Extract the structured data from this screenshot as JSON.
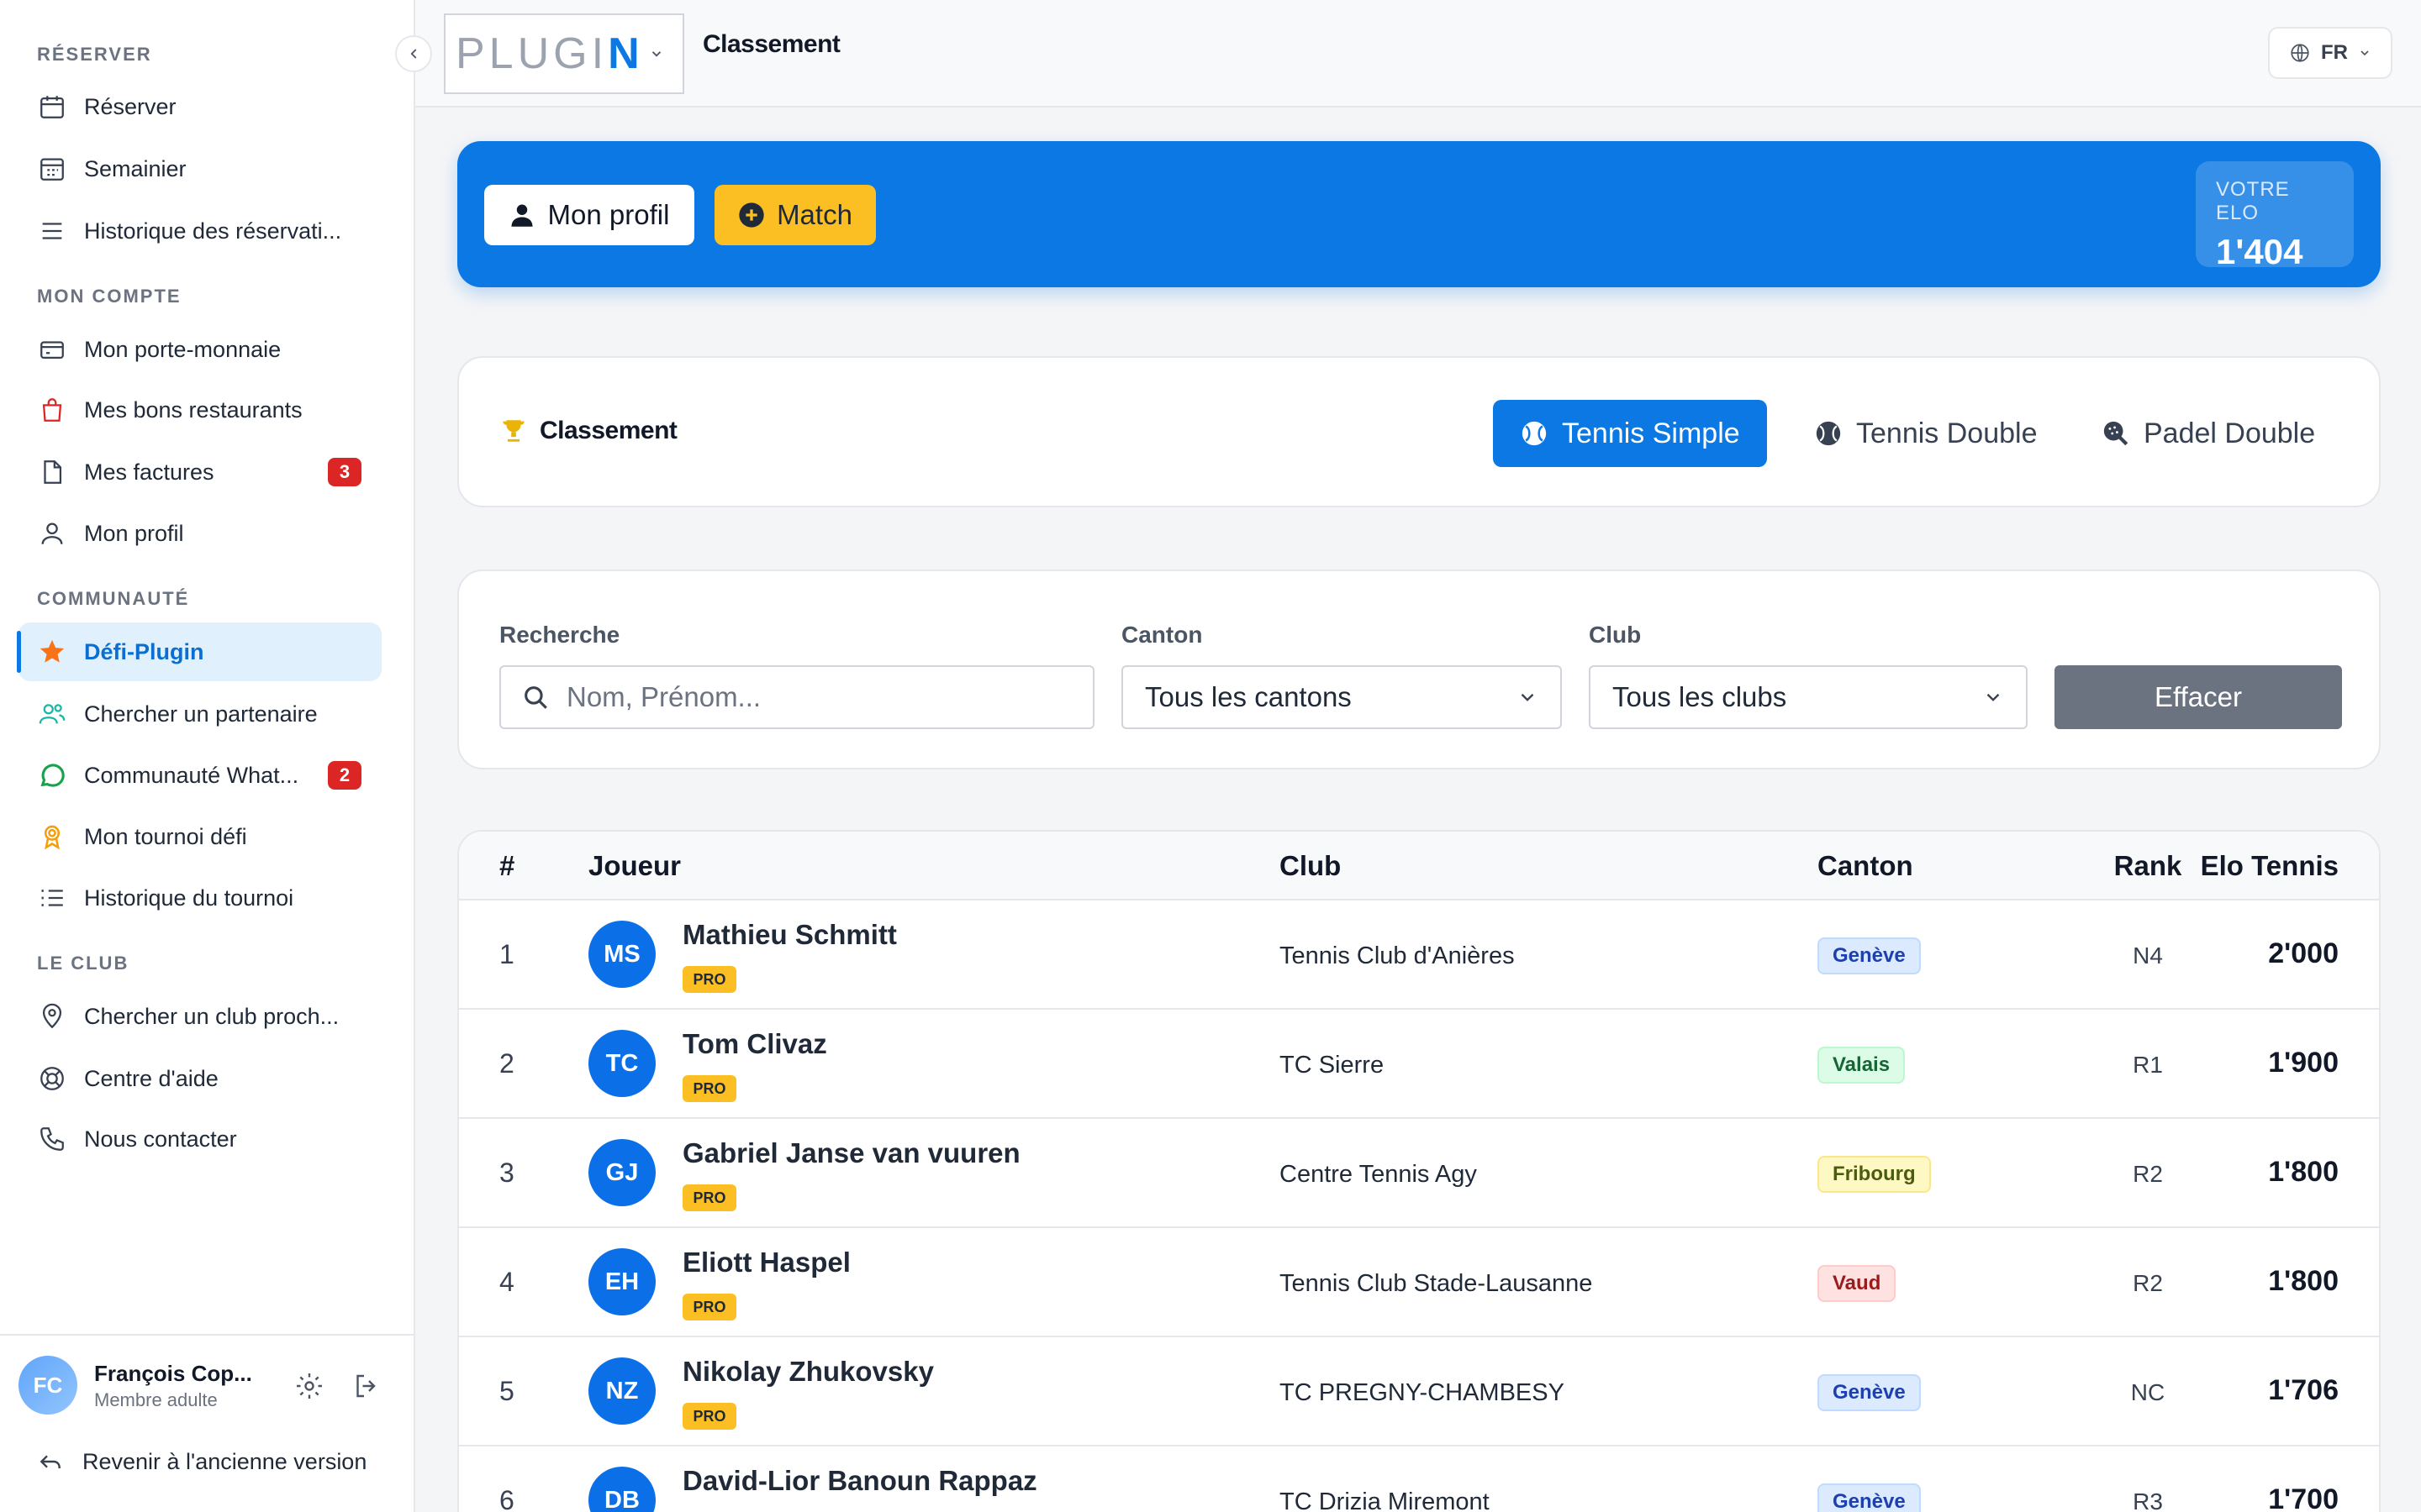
{
  "sidebar": {
    "sections": [
      {
        "title": "RÉSERVER",
        "items": [
          {
            "label": "Réserver",
            "icon": "calendar-icon"
          },
          {
            "label": "Semainier",
            "icon": "calendar-week-icon"
          },
          {
            "label": "Historique des réservati...",
            "icon": "list-icon"
          }
        ]
      },
      {
        "title": "MON COMPTE",
        "items": [
          {
            "label": "Mon porte-monnaie",
            "icon": "wallet-icon"
          },
          {
            "label": "Mes bons restaurants",
            "icon": "shopping-bag-icon"
          },
          {
            "label": "Mes factures",
            "icon": "document-icon",
            "badge": "3"
          },
          {
            "label": "Mon profil",
            "icon": "user-icon"
          }
        ]
      },
      {
        "title": "COMMUNAUTÉ",
        "items": [
          {
            "label": "Défi-Plugin",
            "icon": "star-icon",
            "active": true
          },
          {
            "label": "Chercher un partenaire",
            "icon": "users-icon"
          },
          {
            "label": "Communauté What...",
            "icon": "whatsapp-icon",
            "badge": "2"
          },
          {
            "label": "Mon tournoi défi",
            "icon": "award-icon"
          },
          {
            "label": "Historique du tournoi",
            "icon": "list-ordered-icon"
          }
        ]
      },
      {
        "title": "LE CLUB",
        "items": [
          {
            "label": "Chercher un club proch...",
            "icon": "map-pin-icon"
          },
          {
            "label": "Centre d'aide",
            "icon": "lifebuoy-icon"
          },
          {
            "label": "Nous contacter",
            "icon": "phone-icon"
          }
        ]
      }
    ],
    "user": {
      "initials": "FC",
      "name": "François Cop...",
      "role": "Membre adulte"
    },
    "revert_label": "Revenir à l'ancienne version"
  },
  "header": {
    "logo_text": "PLUGI",
    "logo_accent": "N",
    "title": "Classement",
    "lang": "FR"
  },
  "banner": {
    "profile_label": "Mon profil",
    "match_label": "Match",
    "elo_label": "VOTRE ELO",
    "elo_value": "1'404"
  },
  "ranking": {
    "title": "Classement",
    "tabs": [
      {
        "label": "Tennis Simple",
        "active": true
      },
      {
        "label": "Tennis Double",
        "active": false
      },
      {
        "label": "Padel Double",
        "active": false
      }
    ]
  },
  "filters": {
    "search_label": "Recherche",
    "search_placeholder": "Nom, Prénom...",
    "canton_label": "Canton",
    "canton_value": "Tous les cantons",
    "club_label": "Club",
    "club_value": "Tous les clubs",
    "clear_label": "Effacer"
  },
  "table": {
    "headers": {
      "num": "#",
      "player": "Joueur",
      "club": "Club",
      "canton": "Canton",
      "rank": "Rank",
      "elo": "Elo Tennis"
    },
    "rows": [
      {
        "num": "1",
        "initials": "MS",
        "name": "Mathieu Schmitt",
        "badge": "PRO",
        "club": "Tennis Club d'Anières",
        "canton": "Genève",
        "canton_color": "geneve",
        "rank": "N4",
        "elo": "2'000"
      },
      {
        "num": "2",
        "initials": "TC",
        "name": "Tom Clivaz",
        "badge": "PRO",
        "club": "TC Sierre",
        "canton": "Valais",
        "canton_color": "valais",
        "rank": "R1",
        "elo": "1'900"
      },
      {
        "num": "3",
        "initials": "GJ",
        "name": "Gabriel Janse van vuuren",
        "badge": "PRO",
        "club": "Centre Tennis Agy",
        "canton": "Fribourg",
        "canton_color": "fribourg",
        "rank": "R2",
        "elo": "1'800"
      },
      {
        "num": "4",
        "initials": "EH",
        "name": "Eliott Haspel",
        "badge": "PRO",
        "club": "Tennis Club Stade-Lausanne",
        "canton": "Vaud",
        "canton_color": "vaud",
        "rank": "R2",
        "elo": "1'800"
      },
      {
        "num": "5",
        "initials": "NZ",
        "name": "Nikolay Zhukovsky",
        "badge": "PRO",
        "club": "TC PREGNY-CHAMBESY",
        "canton": "Genève",
        "canton_color": "geneve",
        "rank": "NC",
        "elo": "1'706"
      },
      {
        "num": "6",
        "initials": "DB",
        "name": "David-Lior Banoun Rappaz",
        "badge": "PRO",
        "club": "TC Drizia Miremont",
        "canton": "Genève",
        "canton_color": "geneve",
        "rank": "R3",
        "elo": "1'700"
      }
    ]
  },
  "colors": {
    "primary": "#0b78e3",
    "accent_yellow": "#fbbf24",
    "badge_red": "#dc2626",
    "geneve_bg": "#dbeafe",
    "valais_bg": "#dcfce7",
    "fribourg_bg": "#fef9c3",
    "vaud_bg": "#fee2e2"
  }
}
